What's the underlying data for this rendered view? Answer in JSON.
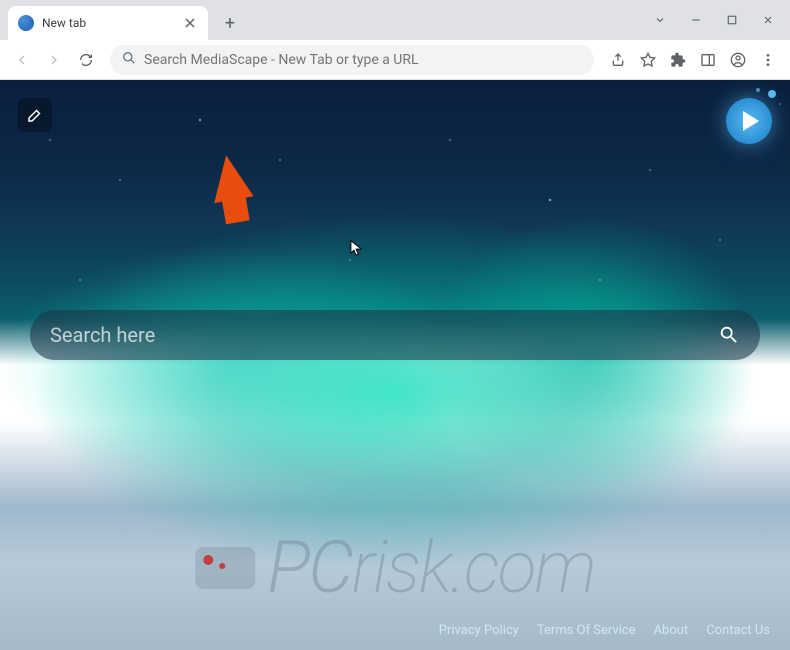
{
  "tab": {
    "title": "New tab"
  },
  "omnibox": {
    "placeholder": "Search MediaScape - New Tab or type a URL"
  },
  "page": {
    "search_placeholder": "Search here"
  },
  "footer": {
    "links": [
      "Privacy Policy",
      "Terms Of Service",
      "About",
      "Contact Us"
    ]
  },
  "watermark": {
    "text_prefix": "PC",
    "text_suffix": "risk.com"
  }
}
